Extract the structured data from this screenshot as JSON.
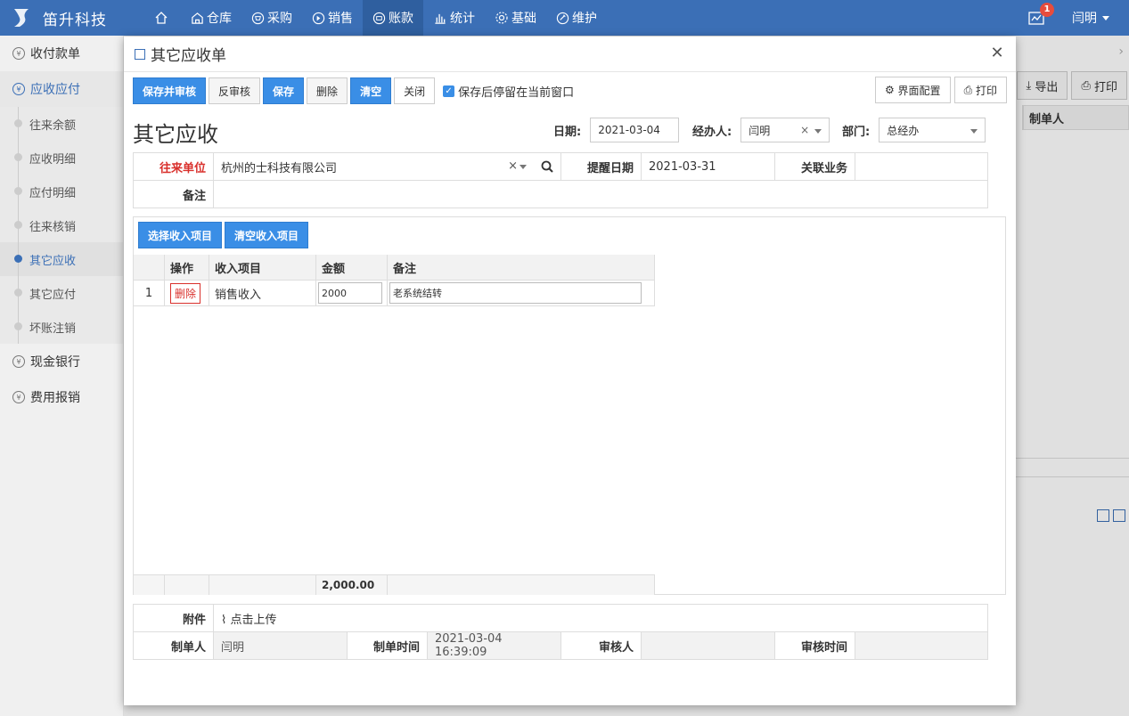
{
  "brand": {
    "name": "笛升科技"
  },
  "nav": {
    "items": [
      {
        "label": "",
        "icon": "home-icon"
      },
      {
        "label": "仓库",
        "icon": "warehouse-icon"
      },
      {
        "label": "采购",
        "icon": "purchase-icon"
      },
      {
        "label": "销售",
        "icon": "sales-icon"
      },
      {
        "label": "账款",
        "icon": "account-icon",
        "active": true
      },
      {
        "label": "统计",
        "icon": "chart-icon"
      },
      {
        "label": "基础",
        "icon": "gear-icon"
      },
      {
        "label": "维护",
        "icon": "maintain-icon"
      }
    ]
  },
  "notifications": {
    "count": "1"
  },
  "user": {
    "name": "闫明"
  },
  "sidebar": {
    "items": [
      {
        "label": "收付款单"
      },
      {
        "label": "应收应付"
      },
      {
        "label": "现金银行"
      },
      {
        "label": "费用报销"
      }
    ],
    "sub_items": [
      {
        "label": "往来余额"
      },
      {
        "label": "应收明细"
      },
      {
        "label": "应付明细"
      },
      {
        "label": "往来核销"
      },
      {
        "label": "其它应收"
      },
      {
        "label": "其它应付"
      },
      {
        "label": "坏账注销"
      }
    ]
  },
  "background": {
    "export_label": "导出",
    "print_label": "打印",
    "col_header": "制单人"
  },
  "modal": {
    "title": "其它应收单",
    "toolbar": {
      "save_audit": "保存并审核",
      "unaudit": "反审核",
      "save": "保存",
      "delete": "删除",
      "clear": "清空",
      "close": "关闭",
      "stay_checkbox": "保存后停留在当前窗口",
      "ui_config": "界面配置",
      "print": "打印"
    },
    "form_title": "其它应收",
    "date": {
      "label": "日期:",
      "value": "2021-03-04"
    },
    "handler": {
      "label": "经办人:",
      "value": "闫明"
    },
    "dept": {
      "label": "部门:",
      "value": "总经办"
    },
    "info": {
      "partner_label": "往来单位",
      "partner_value": "杭州的士科技有限公司",
      "remind_label": "提醒日期",
      "remind_value": "2021-03-31",
      "related_label": "关联业务",
      "related_value": "",
      "remark_label": "备注",
      "remark_value": ""
    },
    "items": {
      "select_btn": "选择收入项目",
      "clear_btn": "清空收入项目",
      "headers": [
        "操作",
        "收入项目",
        "金额",
        "备注"
      ],
      "rows": [
        {
          "no": "1",
          "action": "删除",
          "item": "销售收入",
          "amount": "2000",
          "remark": "老系统结转"
        }
      ],
      "total": "2,000.00"
    },
    "footer": {
      "attach_label": "附件",
      "upload_label": "点击上传",
      "creator_label": "制单人",
      "creator_value": "闫明",
      "created_time_label": "制单时间",
      "created_time_value": "2021-03-04 16:39:09",
      "auditor_label": "审核人",
      "auditor_value": "",
      "audit_time_label": "审核时间",
      "audit_time_value": ""
    }
  }
}
